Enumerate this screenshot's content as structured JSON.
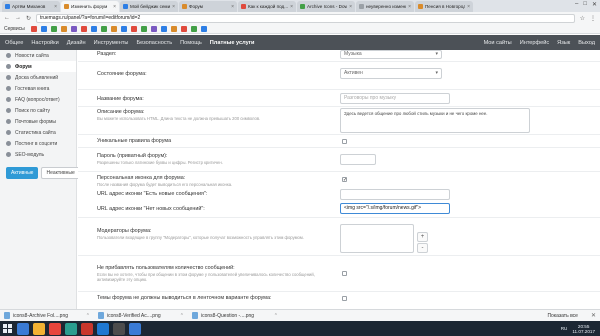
{
  "browser": {
    "tabs": [
      {
        "label": "Артём Миханов",
        "color": "#2d7ee5",
        "active": false
      },
      {
        "label": "Изменить форум",
        "color": "#d98b2b",
        "active": true
      },
      {
        "label": "Мой бейджик семинар",
        "color": "#2d7ee5",
        "active": false
      },
      {
        "label": "Форум",
        "color": "#d98b2b",
        "active": false
      },
      {
        "label": "Как к каждой под...",
        "color": "#e04a3d",
        "active": false
      },
      {
        "label": "Archive Icons - Down",
        "color": "#43a047",
        "active": false
      },
      {
        "label": "неуверенно изменить",
        "color": "#9aa0a6",
        "active": false
      },
      {
        "label": "Пенсия в Новгород",
        "color": "#d98b2b",
        "active": false
      }
    ],
    "url": "truemags.ru/panel/?a=forum/i=editforum/id=2",
    "bookmarks_label": "Сервисы",
    "bookmark_colors": [
      "#e04a3d",
      "#2d7ee5",
      "#43a047",
      "#d98b2b",
      "#7a59c1",
      "#e04a3d",
      "#2d7ee5",
      "#43a047",
      "#d98b2b",
      "#2d7ee5",
      "#e04a3d",
      "#43a047",
      "#7a59c1",
      "#2d7ee5",
      "#d98b2b",
      "#e04a3d",
      "#43a047",
      "#2d7ee5"
    ]
  },
  "adminnav": {
    "items": [
      "Общее",
      "Настройки",
      "Дизайн",
      "Инструменты",
      "Безопасность",
      "Помощь"
    ],
    "paid": "Платные услуги",
    "right": [
      "Мои сайты",
      "Интерфейс",
      "Язык",
      "Выход"
    ]
  },
  "sidebar": {
    "items": [
      {
        "label": "Новости сайта",
        "active": false
      },
      {
        "label": "Форум",
        "active": true
      },
      {
        "label": "Доска объявлений",
        "active": false
      },
      {
        "label": "Гостевая книга",
        "active": false
      },
      {
        "label": "FAQ (вопрос/ответ)",
        "active": false
      },
      {
        "label": "Поиск по сайту",
        "active": false
      },
      {
        "label": "Почтовые формы",
        "active": false
      },
      {
        "label": "Статистика сайта",
        "active": false
      },
      {
        "label": "Постинг в соцсети",
        "active": false
      },
      {
        "label": "SEO-модуль",
        "active": false
      }
    ],
    "btn_active": "Активные",
    "btn_inactive": "Неактивные"
  },
  "form": {
    "section_label": "Раздел:",
    "section_value": "Музыка",
    "state_label": "Состояние форума:",
    "state_value": "Активен",
    "name_label": "Название форума:",
    "name_placeholder": "Разговоры про музыку",
    "desc_label": "Описание форума:",
    "desc_hint": "Вы можете использовать HTML. Длина текста не должна превышать 200 символов.",
    "desc_value": "Здесь ведется общение про любой стиль музыки и не чего кроме нее.",
    "rules_label": "Уникальные правила форума",
    "password_label": "Пароль (приватный форум):",
    "password_hint": "Разрешены только латинские буквы и цифры. Регистр критичен.",
    "icon_label": "Персональная иконка для форума:",
    "icon_hint": "После названия форума будет выводиться его персональная иконка.",
    "icon_new_label": "URL адрес иконки \"Есть новые сообщения\":",
    "icon_nonew_label": "URL адрес иконки \"Нет новых сообщений\":",
    "icon_nonew_value": "<img src=\"/.s/img/forum/news.gif\">",
    "mods_label": "Модераторы форума:",
    "mods_hint": "Пользователи входящие в группу \"Модераторы\", которые получат возможность управлять этим форумом.",
    "mods_plus": "+",
    "mods_minus": "-",
    "nocount_label": "Не прибавлять пользователям количество сообщений:",
    "nocount_hint": "Если вы не хотите, чтобы при общении в этом форуме у пользователей увеличивалось количество сообщений, активизируйте эту опцию.",
    "tape_label": "Темы форума не должны выводиться в ленточном варианте форума:"
  },
  "downloads": {
    "files": [
      "icons8-Archive Fol....png",
      "icons8-Verified Ac....png",
      "icons8-Question -....png"
    ],
    "show_all": "Показать все"
  },
  "taskbar": {
    "apps": [
      "#3a7bd5",
      "#f2b233",
      "#e8453c",
      "#2a9d8f",
      "#c9372c",
      "#1f78d1",
      "#4d4d4d",
      "#3a7bd5"
    ],
    "lang": "RU",
    "time": "20:55",
    "date": "11.07.2017"
  }
}
